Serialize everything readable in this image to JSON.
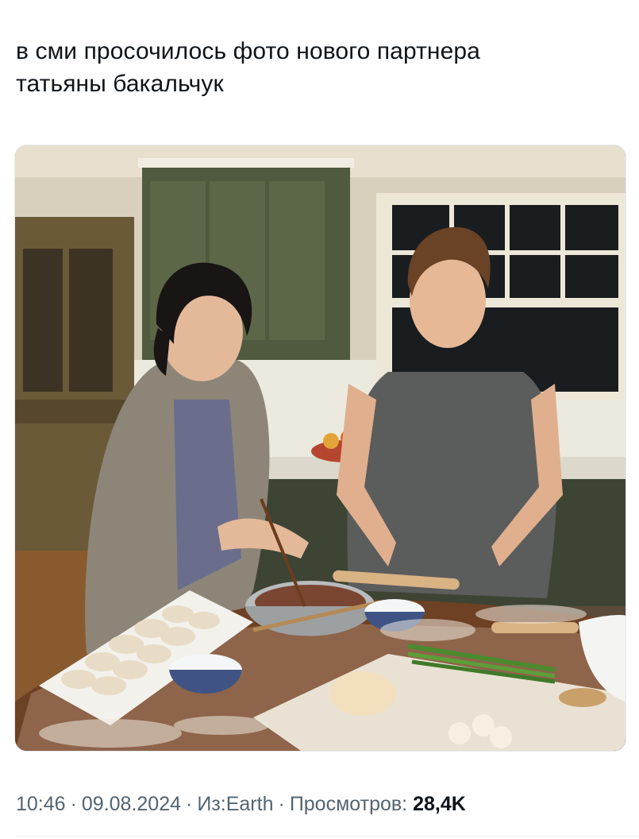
{
  "tweet": {
    "text_line_1": "в сми просочилось фото нового партнера",
    "text_line_2": "татьяны бакальчук"
  },
  "photo": {
    "content": "photo-kitchen-couple-making-dumplings"
  },
  "meta": {
    "time": "10:46",
    "date": "09.08.2024",
    "source": "Из:Earth",
    "views_label": "Просмотров:",
    "views_count": "28,4K",
    "separator": "·"
  }
}
